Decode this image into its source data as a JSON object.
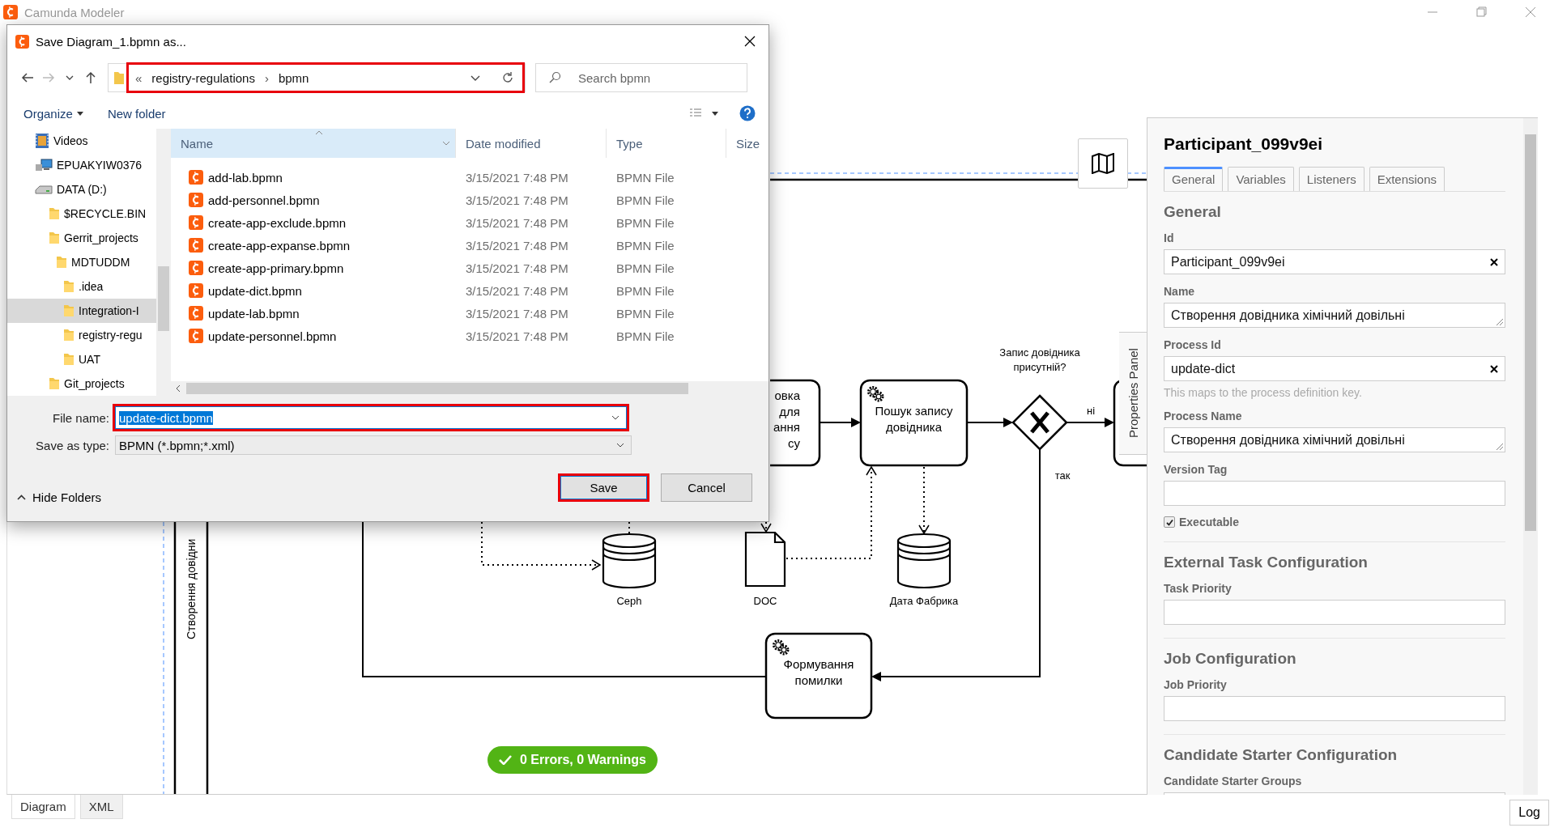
{
  "window": {
    "title": "Camunda Modeler"
  },
  "dialog": {
    "title": "Save Diagram_1.bpmn as...",
    "address": {
      "overflow": "«",
      "segments": [
        "registry-regulations",
        "bpmn"
      ],
      "separator": "›",
      "highlighted": true
    },
    "search": {
      "placeholder": "Search bpmn"
    },
    "toolbar": [
      "Organize",
      "New folder"
    ],
    "tree": [
      {
        "label": "Videos",
        "kind": "videos",
        "selected": false
      },
      {
        "label": "EPUAKYIW0376",
        "kind": "computer",
        "selected": false
      },
      {
        "label": "DATA (D:)",
        "kind": "drive",
        "selected": false,
        "children": [
          {
            "label": "$RECYCLE.BIN",
            "kind": "folder",
            "selected": false
          },
          {
            "label": "Gerrit_projects",
            "kind": "folder",
            "selected": false,
            "children": [
              {
                "label": "MDTUDDM",
                "kind": "folder",
                "selected": false,
                "children": [
                  {
                    "label": ".idea",
                    "kind": "folder",
                    "selected": false
                  },
                  {
                    "label": "Integration-I",
                    "kind": "folder",
                    "selected": true
                  },
                  {
                    "label": "registry-regu",
                    "kind": "folder",
                    "selected": false
                  },
                  {
                    "label": "UAT",
                    "kind": "folder",
                    "selected": false
                  }
                ]
              }
            ]
          },
          {
            "label": "Git_projects",
            "kind": "folder",
            "selected": false
          }
        ]
      }
    ],
    "columns": [
      {
        "label": "Name",
        "selected": true
      },
      {
        "label": "Date modified",
        "selected": false
      },
      {
        "label": "Type",
        "selected": false
      },
      {
        "label": "Size",
        "selected": false
      }
    ],
    "files": [
      {
        "name": "add-lab.bpmn",
        "date": "3/15/2021 7:48 PM",
        "type": "BPMN File"
      },
      {
        "name": "add-personnel.bpmn",
        "date": "3/15/2021 7:48 PM",
        "type": "BPMN File"
      },
      {
        "name": "create-app-exclude.bpmn",
        "date": "3/15/2021 7:48 PM",
        "type": "BPMN File"
      },
      {
        "name": "create-app-expanse.bpmn",
        "date": "3/15/2021 7:48 PM",
        "type": "BPMN File"
      },
      {
        "name": "create-app-primary.bpmn",
        "date": "3/15/2021 7:48 PM",
        "type": "BPMN File"
      },
      {
        "name": "update-dict.bpmn",
        "date": "3/15/2021 7:48 PM",
        "type": "BPMN File"
      },
      {
        "name": "update-lab.bpmn",
        "date": "3/15/2021 7:48 PM",
        "type": "BPMN File"
      },
      {
        "name": "update-personnel.bpmn",
        "date": "3/15/2021 7:48 PM",
        "type": "BPMN File"
      }
    ],
    "file_name": {
      "label": "File name:",
      "value": "update-dict.bpmn",
      "highlighted": true
    },
    "save_as_type": {
      "label": "Save as type:",
      "value": "BPMN (*.bpmn;*.xml)"
    },
    "hide_folders": "Hide Folders",
    "buttons": [
      {
        "label": "Save",
        "highlighted": true
      },
      {
        "label": "Cancel",
        "highlighted": false
      }
    ]
  },
  "diagram": {
    "lane_label": "Створення довідни",
    "elements": [
      {
        "kind": "task",
        "lines": [
          "овка",
          "для",
          "ання",
          "су"
        ]
      },
      {
        "kind": "service_task",
        "lines": [
          "Пошук запису",
          "довідника"
        ]
      },
      {
        "kind": "gateway",
        "lines": [
          "Запис довідника",
          "присутній?"
        ]
      },
      {
        "kind": "flow_label",
        "lines": [
          "ні"
        ]
      },
      {
        "kind": "flow_label",
        "lines": [
          "так"
        ]
      },
      {
        "kind": "datastore",
        "lines": [
          "Ceph"
        ]
      },
      {
        "kind": "document",
        "lines": [
          "DOC"
        ]
      },
      {
        "kind": "datastore",
        "lines": [
          "Дата Фабрика"
        ]
      },
      {
        "kind": "service_task",
        "lines": [
          "Формування",
          "помилки"
        ]
      }
    ]
  },
  "properties_toggle": "Properties Panel",
  "status": "0 Errors, 0 Warnings",
  "properties": {
    "title": "Participant_099v9ei",
    "tabs": [
      {
        "label": "General",
        "selected": true
      },
      {
        "label": "Variables",
        "selected": false
      },
      {
        "label": "Listeners",
        "selected": false
      },
      {
        "label": "Extensions",
        "selected": false
      }
    ],
    "groups": [
      {
        "title": "General",
        "entries": [
          {
            "kind": "text",
            "label": "Id",
            "value": "Participant_099v9ei",
            "clearable": true
          },
          {
            "kind": "textarea",
            "label": "Name",
            "value": "Створення довідника хімічний довільні"
          },
          {
            "kind": "text",
            "label": "Process Id",
            "value": "update-dict",
            "clearable": true,
            "hint": "This maps to the process definition key."
          },
          {
            "kind": "textarea",
            "label": "Process Name",
            "value": "Створення довідника хімічний довільні"
          },
          {
            "kind": "text",
            "label": "Version Tag"
          },
          {
            "kind": "checkbox",
            "label": "Executable",
            "checked": true
          }
        ]
      },
      {
        "title": "External Task Configuration",
        "entries": [
          {
            "kind": "text",
            "label": "Task Priority"
          }
        ]
      },
      {
        "title": "Job Configuration",
        "entries": [
          {
            "kind": "text",
            "label": "Job Priority"
          }
        ]
      },
      {
        "title": "Candidate Starter Configuration",
        "entries": [
          {
            "kind": "text",
            "label": "Candidate Starter Groups"
          }
        ]
      }
    ]
  },
  "view_tabs": [
    {
      "label": "Diagram",
      "selected": true
    },
    {
      "label": "XML",
      "selected": false
    }
  ],
  "log_button": "Log"
}
